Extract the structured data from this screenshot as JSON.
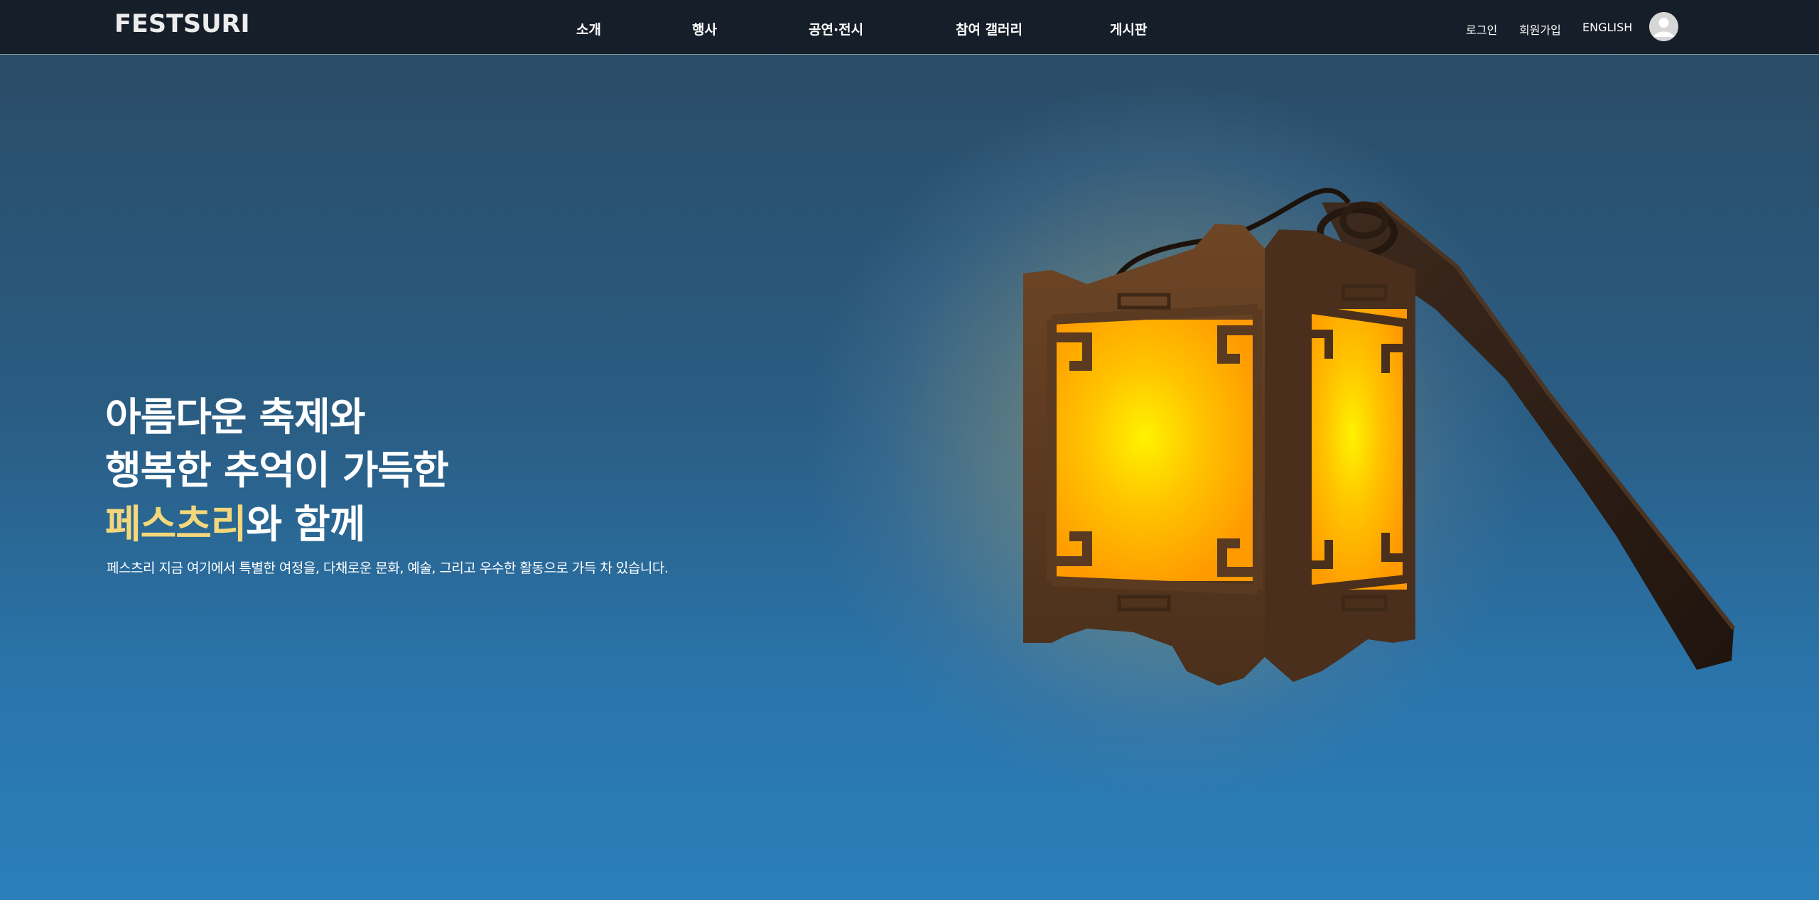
{
  "header": {
    "logo": "FESTSURI",
    "nav": [
      {
        "label": "소개"
      },
      {
        "label": "행사"
      },
      {
        "label": "공연·전시"
      },
      {
        "label": "참여 갤러리"
      },
      {
        "label": "게시판"
      }
    ],
    "utility": {
      "login": "로그인",
      "signup": "회원가입",
      "language": "ENGLISH"
    },
    "avatar_icon": "user-avatar-icon"
  },
  "hero": {
    "line1": "아름다운 축제와",
    "line2": "행복한 추억이 가득한",
    "line3_highlight": "페스츠리",
    "line3_rest": "와 함께",
    "subtitle": "페스츠리 지금 여기에서 특별한 여정을, 다채로운 문화, 예술, 그리고 우수한 활동으로 가득 차 있습니다."
  },
  "colors": {
    "header_bg": "#161f29",
    "highlight": "#f3d77a",
    "lantern_glow": "#ffd000"
  }
}
